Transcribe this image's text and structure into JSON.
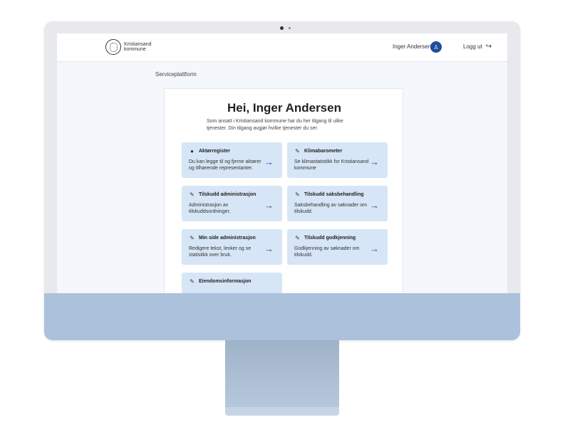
{
  "header": {
    "logo_line1": "Kristiansand",
    "logo_line2": "kommune",
    "user_name": "Inger Andersen",
    "avatar_icon": "person-icon",
    "logout_label": "Logg ut",
    "logout_icon": "logout-icon"
  },
  "breadcrumb": "Serviceplattform",
  "main": {
    "title": "Hei, Inger Andersen",
    "intro": "Som ansatt i Kristiansand kommune har du her tilgang til ulike tjenester. Din tilgang avgjør hvilke tjenester du ser."
  },
  "services": [
    {
      "title": "Aktørregister",
      "icon": "user-icon",
      "description": "Du kan legge til og fjerne aktører og tilhørende representanter."
    },
    {
      "title": "Klimabarometer",
      "icon": "pencil-icon",
      "description": "Se klimastatistikk for Kristiansand kommune"
    },
    {
      "title": "Tilskudd administrasjon",
      "icon": "pencil-icon",
      "description": "Administrasjon av tilskuddsordninger."
    },
    {
      "title": "Tilskudd saksbehandling",
      "icon": "pencil-icon",
      "description": "Saksbehandling av søknader om tilskudd."
    },
    {
      "title": "Min side administrasjon",
      "icon": "pencil-icon",
      "description": "Redigere tekst, lenker og se statistikk over bruk."
    },
    {
      "title": "Tilskudd godkjenning",
      "icon": "pencil-icon",
      "description": "Godkjenning av søknader om tilskudd."
    },
    {
      "title": "Eiendomsinformasjon",
      "icon": "pencil-icon",
      "description": ""
    }
  ],
  "colors": {
    "accent": "#1d4f9a",
    "tile_background": "#d6e6f6",
    "monitor_chin": "#abc1dc"
  }
}
